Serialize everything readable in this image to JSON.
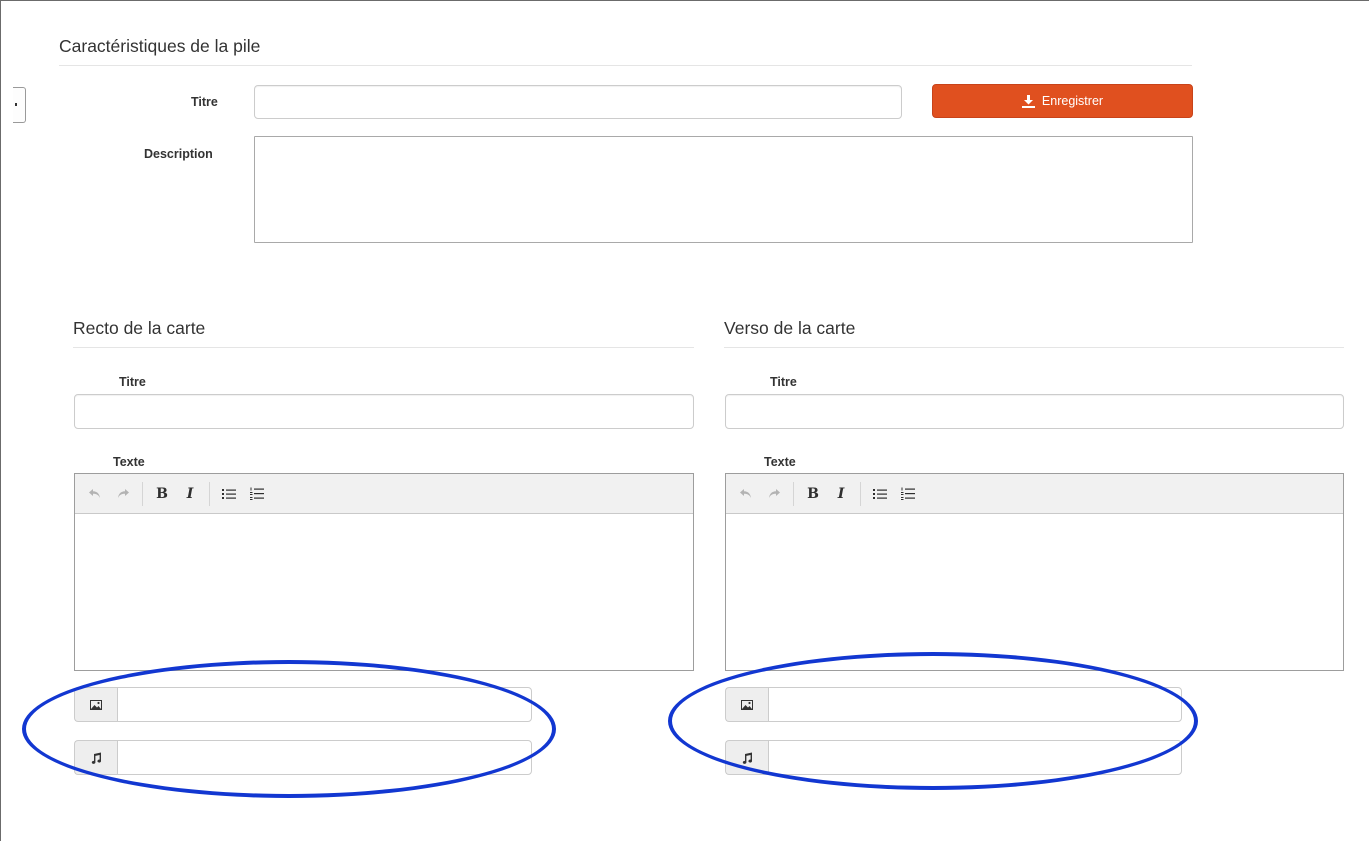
{
  "pile": {
    "section_title": "Caractéristiques de la pile",
    "title_label": "Titre",
    "title_value": "",
    "description_label": "Description",
    "description_value": "",
    "save_label": "Enregistrer"
  },
  "recto": {
    "section_title": "Recto de la carte",
    "title_label": "Titre",
    "title_value": "",
    "text_label": "Texte",
    "image_value": "",
    "audio_value": ""
  },
  "verso": {
    "section_title": "Verso de la carte",
    "title_label": "Titre",
    "title_value": "",
    "text_label": "Texte",
    "image_value": "",
    "audio_value": ""
  },
  "toolbar_icons": [
    "undo-icon",
    "redo-icon",
    "bold-icon",
    "italic-icon",
    "bullet-list-icon",
    "numbered-list-icon"
  ],
  "colors": {
    "save_button": "#e0501f",
    "highlight_ellipse": "#1237d1"
  }
}
